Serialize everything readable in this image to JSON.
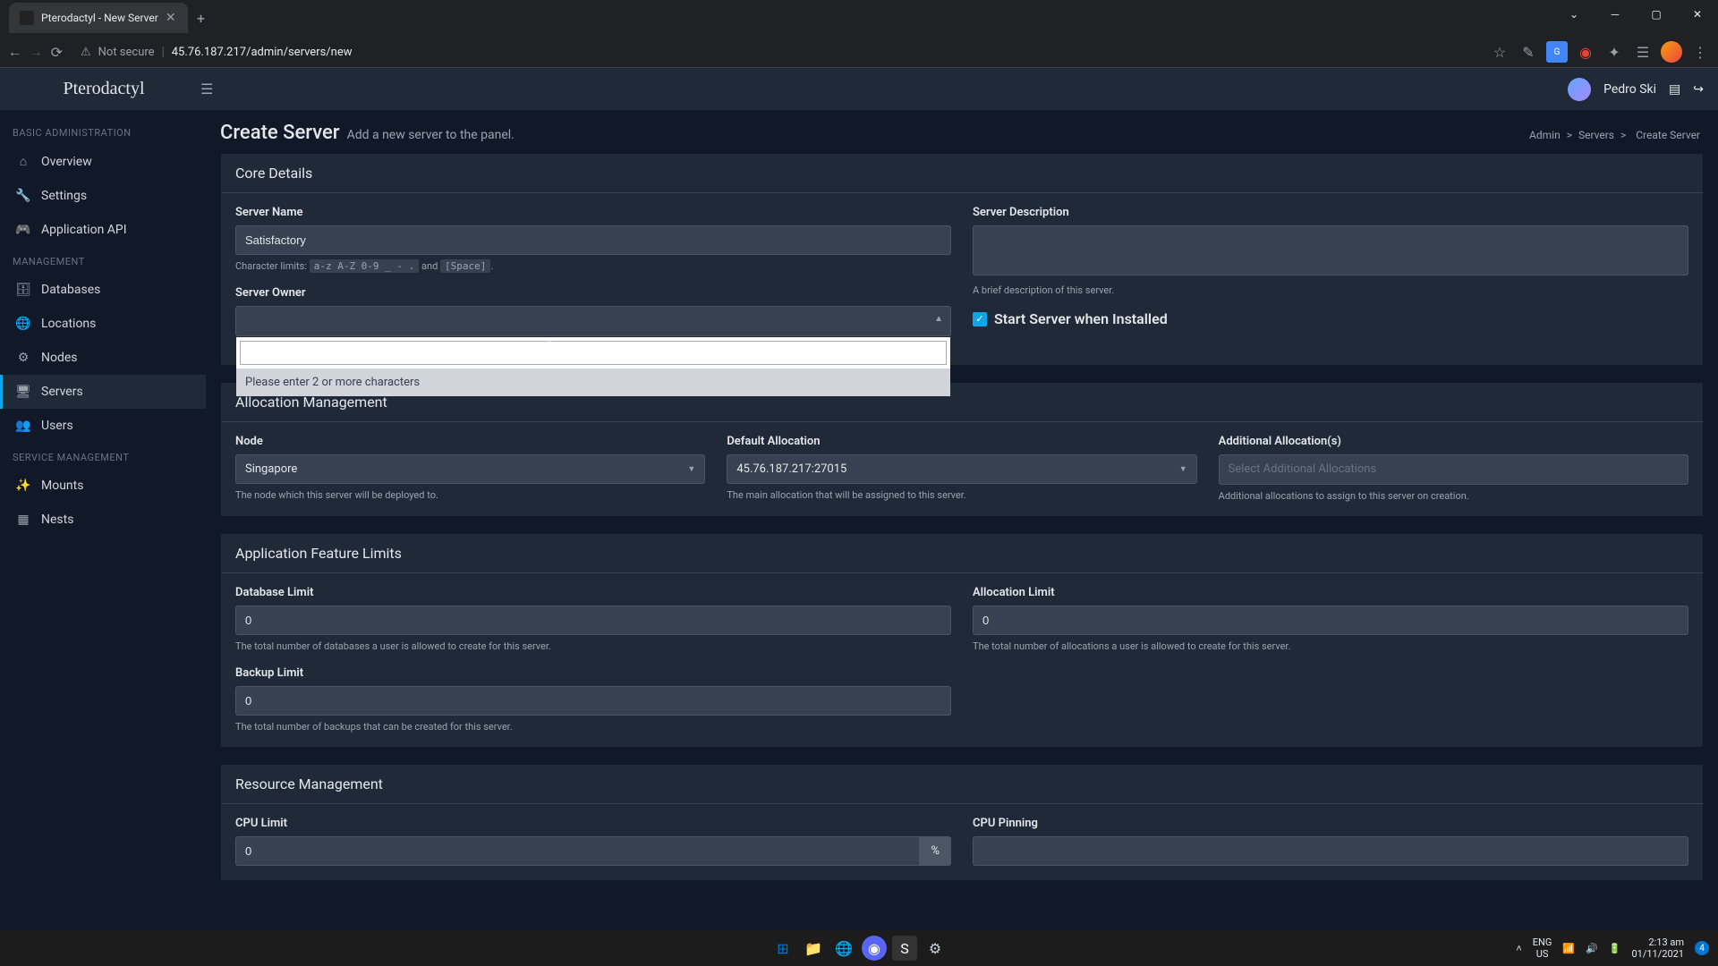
{
  "browser": {
    "tab_title": "Pterodactyl - New Server",
    "not_secure": "Not secure",
    "url": "45.76.187.217/admin/servers/new"
  },
  "topbar": {
    "brand": "Pterodactyl",
    "user_name": "Pedro Ski"
  },
  "sidebar": {
    "sections": {
      "basic": "BASIC ADMINISTRATION",
      "management": "MANAGEMENT",
      "service": "SERVICE MANAGEMENT"
    },
    "items": {
      "overview": "Overview",
      "settings": "Settings",
      "api": "Application API",
      "databases": "Databases",
      "locations": "Locations",
      "nodes": "Nodes",
      "servers": "Servers",
      "users": "Users",
      "mounts": "Mounts",
      "nests": "Nests"
    }
  },
  "page": {
    "title": "Create Server",
    "subtitle": "Add a new server to the panel.",
    "breadcrumb": {
      "admin": "Admin",
      "servers": "Servers",
      "current": "Create Server"
    }
  },
  "core": {
    "header": "Core Details",
    "name_label": "Server Name",
    "name_value": "Satisfactory",
    "char_limits_prefix": "Character limits:",
    "char_limits_code": "a-z A-Z 0-9 _ - .",
    "char_limits_and": "and",
    "char_limits_space": "[Space]",
    "owner_label": "Server Owner",
    "owner_search_msg": "Please enter 2 or more characters",
    "desc_label": "Server Description",
    "desc_help": "A brief description of this server.",
    "start_label": "Start Server when Installed"
  },
  "alloc": {
    "header": "Allocation Management",
    "node_label": "Node",
    "node_value": "Singapore",
    "node_help": "The node which this server will be deployed to.",
    "default_label": "Default Allocation",
    "default_value": "45.76.187.217:27015",
    "default_help": "The main allocation that will be assigned to this server.",
    "additional_label": "Additional Allocation(s)",
    "additional_placeholder": "Select Additional Allocations",
    "additional_help": "Additional allocations to assign to this server on creation."
  },
  "limits": {
    "header": "Application Feature Limits",
    "db_label": "Database Limit",
    "db_value": "0",
    "db_help": "The total number of databases a user is allowed to create for this server.",
    "alloc_label": "Allocation Limit",
    "alloc_value": "0",
    "alloc_help": "The total number of allocations a user is allowed to create for this server.",
    "backup_label": "Backup Limit",
    "backup_value": "0",
    "backup_help": "The total number of backups that can be created for this server."
  },
  "resource": {
    "header": "Resource Management",
    "cpu_label": "CPU Limit",
    "cpu_value": "0",
    "cpu_unit": "%",
    "pin_label": "CPU Pinning"
  },
  "taskbar": {
    "lang1": "ENG",
    "lang2": "US",
    "time": "2:13 am",
    "date": "01/11/2021",
    "notif_count": "4"
  }
}
